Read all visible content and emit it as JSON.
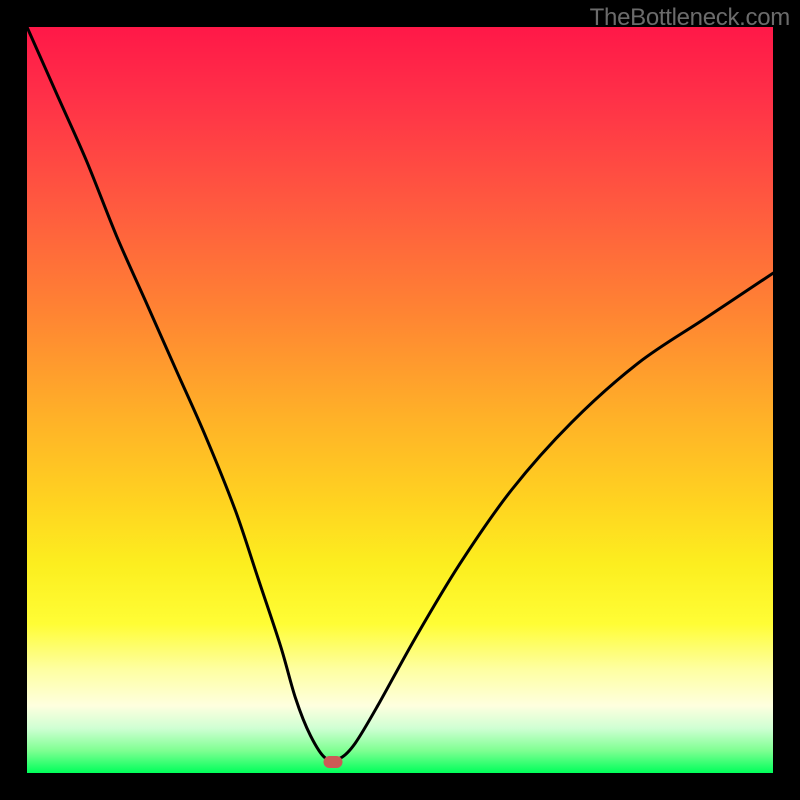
{
  "watermark": "TheBottleneck.com",
  "colors": {
    "frame_bg": "#000000",
    "curve_stroke": "#000000",
    "marker_fill": "#cc5a56"
  },
  "chart_data": {
    "type": "line",
    "title": "",
    "xlabel": "",
    "ylabel": "",
    "xlim": [
      0,
      100
    ],
    "ylim": [
      0,
      100
    ],
    "grid": false,
    "marker": {
      "x": 41,
      "y": 1.5
    },
    "series": [
      {
        "name": "bottleneck-curve",
        "x": [
          0,
          4,
          8,
          12,
          16,
          20,
          24,
          28,
          31,
          34,
          36,
          38,
          40,
          42,
          44,
          47,
          52,
          58,
          65,
          73,
          82,
          91,
          100
        ],
        "y": [
          100,
          91,
          82,
          72,
          63,
          54,
          45,
          35,
          26,
          17,
          10,
          5,
          2,
          2,
          4,
          9,
          18,
          28,
          38,
          47,
          55,
          61,
          67
        ]
      }
    ],
    "annotations": []
  }
}
